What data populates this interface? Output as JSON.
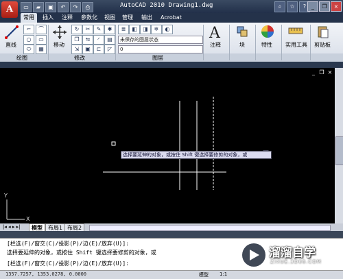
{
  "window": {
    "title": "AutoCAD 2010  Drawing1.dwg",
    "logo_letter": "A"
  },
  "tabs": [
    "常用",
    "插入",
    "注释",
    "参数化",
    "视图",
    "管理",
    "输出",
    "Acrobat"
  ],
  "ribbon": {
    "draw_panel_label": "绘图",
    "modify_panel_label": "修改",
    "layers_panel_label": "图层",
    "line_label": "直线",
    "move_label": "移动",
    "annotation_label": "注释",
    "block_label": "块",
    "properties_label": "特性",
    "utilities_label": "实用工具",
    "clipboard_label": "剪贴板",
    "layer_state": "未保存的图层状态",
    "layer_current": "0"
  },
  "canvas": {
    "tooltip": "选择要延伸的对象，或按住 Shift 键选择要修剪的对象，或",
    "ucs_x": "X",
    "ucs_y": "Y"
  },
  "layout_tabs": [
    "模型",
    "布局1",
    "布局2"
  ],
  "command": {
    "line1": "[栏选(F)/窗交(C)/投影(P)/边(E)/放弃(U)]:",
    "line2": "选择要延伸的对象，或按住 Shift 键选择要修剪的对象，或",
    "line3": "[栏选(F)/窗交(C)/投影(P)/边(E)/放弃(U)]:"
  },
  "status": {
    "coords": "1357.7257,  1353.0278,  0.0000",
    "model_label": "模型",
    "scale": "1:1"
  },
  "watermark": {
    "brand": "溜溜自学",
    "url": "ZIXUE.3D66.COM"
  },
  "colors": {
    "accent_red": "#d03a2c",
    "canvas_bg": "#000000",
    "title_bg": "#2a3a55"
  }
}
